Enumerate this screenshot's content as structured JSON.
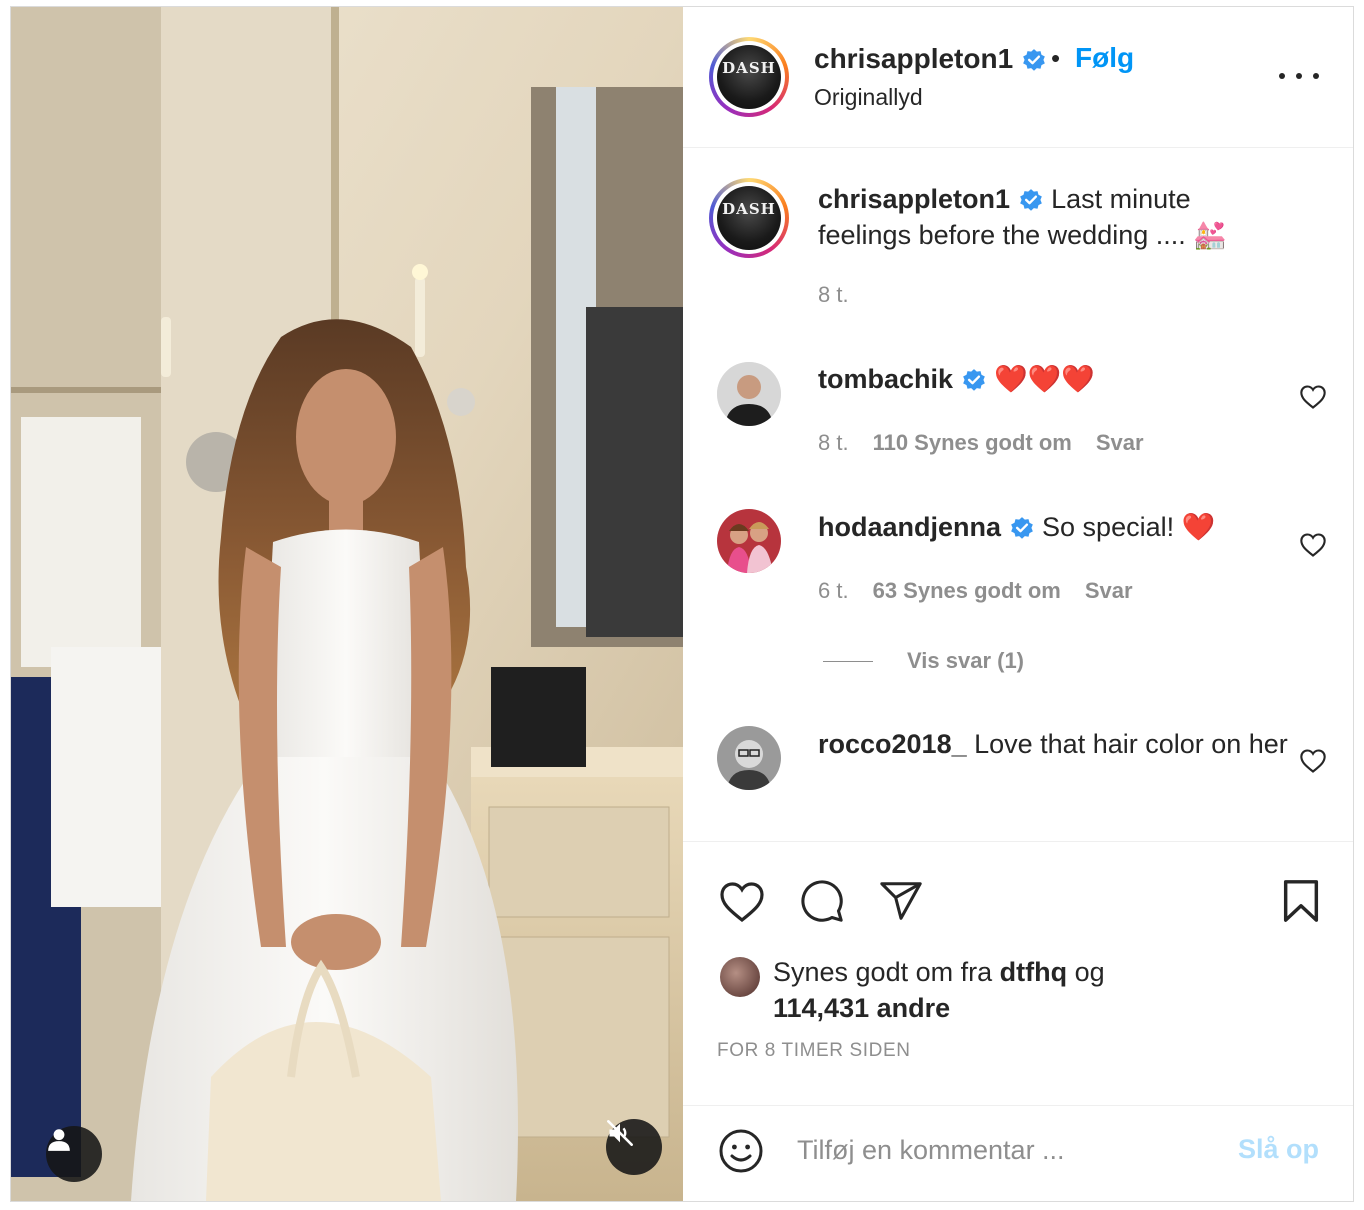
{
  "post": {
    "author": "chrisappleton1",
    "follow_label": "Følg",
    "dot": "•",
    "audio": "Originallyd",
    "avatar_text": "DASH",
    "more_icon": "more-horizontal-icon"
  },
  "caption": {
    "username": "chrisappleton1",
    "text": " Last minute feelings before the wedding .... 💒",
    "time": "8 t."
  },
  "comments": [
    {
      "username": "tombachik",
      "text": " ❤️❤️❤️",
      "time": "8 t.",
      "likes": "110 Synes godt om",
      "reply": "Svar"
    },
    {
      "username": "hodaandjenna",
      "text": " So special! ❤️",
      "time": "6 t.",
      "likes": "63 Synes godt om",
      "reply": "Svar"
    },
    {
      "username": "rocco2018_",
      "text": " Love that hair color on her"
    }
  ],
  "view_replies": "Vis svar (1)",
  "likes": {
    "prefix": "Synes godt om fra ",
    "user": "dtfhq",
    "middle": " og ",
    "count": "114,431 andre"
  },
  "timestamp": "FOR 8 TIMER SIDEN",
  "composer": {
    "placeholder": "Tilføj en kommentar ...",
    "post_label": "Slå op"
  },
  "colors": {
    "accent": "#0095f6",
    "muted": "#8e8e8e",
    "verified": "#3897f0",
    "post_disabled": "#b2dffc"
  }
}
